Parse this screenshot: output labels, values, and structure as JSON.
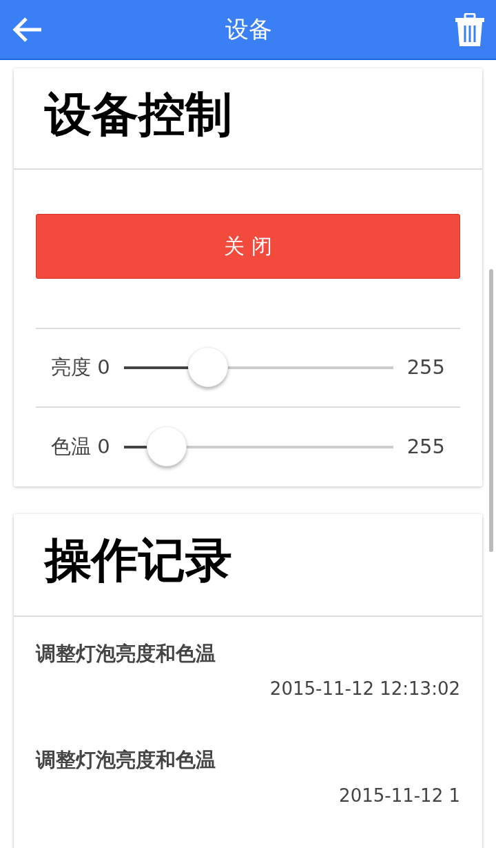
{
  "app_bar": {
    "title": "设备"
  },
  "control_card": {
    "title": "设备控制",
    "power_button": "关 闭",
    "sliders": [
      {
        "label": "亮度 0",
        "level": 0.28,
        "max": "255"
      },
      {
        "label": "色温 0",
        "level": 0.1,
        "max": "255"
      }
    ]
  },
  "log_card": {
    "title": "操作记录",
    "entries": [
      {
        "text": "调整灯泡亮度和色温",
        "time": "2015-11-12 12:13:02"
      },
      {
        "text": "调整灯泡亮度和色温",
        "time": "2015-11-12 1"
      }
    ]
  }
}
